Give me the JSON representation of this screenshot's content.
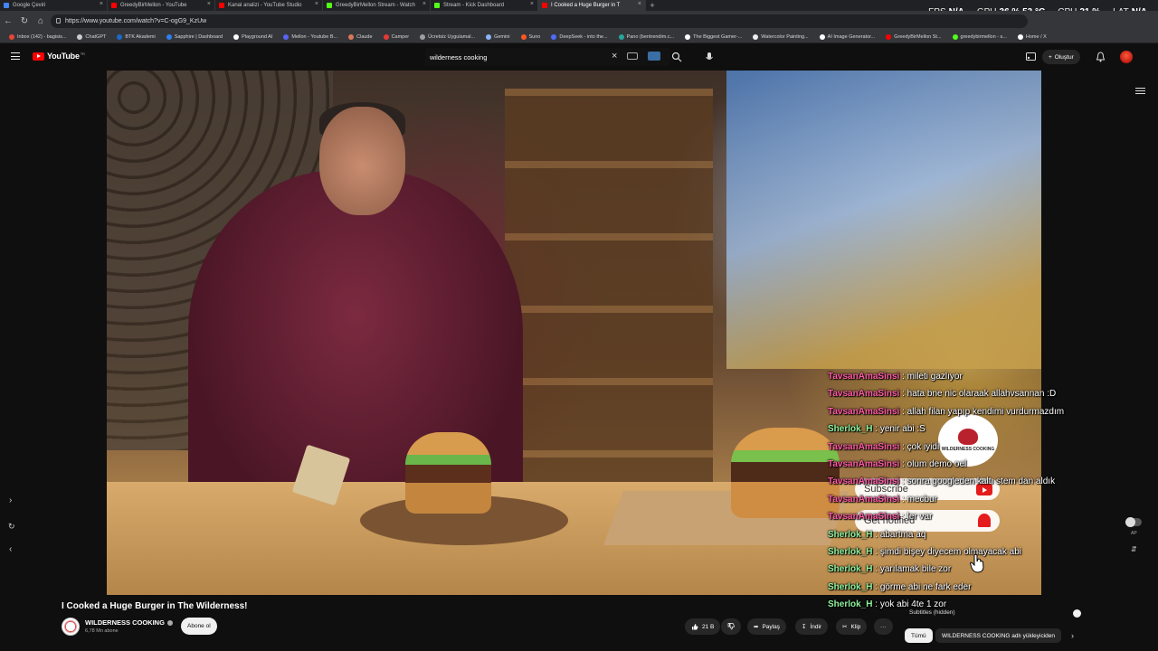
{
  "browser": {
    "tabs": [
      {
        "label": "Google Çeviri",
        "color": "#4285f4"
      },
      {
        "label": "GreedyBirMellon - YouTube",
        "color": "#ff0000"
      },
      {
        "label": "Kanal analizi - YouTube Studio",
        "color": "#ff0000"
      },
      {
        "label": "GreedyBirMellon Stream - Watch",
        "color": "#53fc18"
      },
      {
        "label": "Stream - Kick Dashboard",
        "color": "#53fc18"
      },
      {
        "label": "I Cooked a Huge Burger in T",
        "color": "#ff0000",
        "active": true
      }
    ],
    "new_tab": "+",
    "url": "https://www.youtube.com/watch?v=C-ogG9_KzUw",
    "bookmarks": [
      {
        "label": "Inbox (142) - bagisis...",
        "color": "#ea4335"
      },
      {
        "label": "ChatGPT",
        "color": "#cccccc"
      },
      {
        "label": "BTK Akademi",
        "color": "#1b6ac9"
      },
      {
        "label": "Sapphire | Dashboard",
        "color": "#2f80ed"
      },
      {
        "label": "Playground AI",
        "color": "#ffffff"
      },
      {
        "label": "Mellon - Youtube B...",
        "color": "#5865f2"
      },
      {
        "label": "Claude",
        "color": "#d97757"
      },
      {
        "label": "Camper",
        "color": "#e53935"
      },
      {
        "label": "Ücretsiz Uygulamal...",
        "color": "#9e9e9e"
      },
      {
        "label": "Gemini",
        "color": "#8ab4f8"
      },
      {
        "label": "Suno",
        "color": "#ff5722"
      },
      {
        "label": "DeepSeek - into the...",
        "color": "#4d6bfe"
      },
      {
        "label": "Pano (bentrendim.c...",
        "color": "#26a69a"
      },
      {
        "label": "The Biggest Gamer-...",
        "color": "#ffffff"
      },
      {
        "label": "Watercolor Painting...",
        "color": "#eeeeee"
      },
      {
        "label": "AI Image Generator...",
        "color": "#ffffff"
      },
      {
        "label": "GreedyBirMellon St...",
        "color": "#ff0000"
      },
      {
        "label": "greedybirmellon - s...",
        "color": "#53fc18"
      },
      {
        "label": "Home / X",
        "color": "#ffffff"
      }
    ]
  },
  "stats_overlay": {
    "fps_label": "FPS",
    "fps_value": "N/A",
    "gpu_label": "GPU",
    "gpu_value": "36 % 53 °C",
    "cpu_label": "CPU",
    "cpu_value": "21 %",
    "lat_label": "LAT",
    "lat_value": "N/A"
  },
  "youtube": {
    "logo_text": "YouTube",
    "region": "TR",
    "search_value": "wilderness cooking",
    "create_label": "Oluştur",
    "video_title": "I Cooked a Huge Burger in The Wilderness!",
    "channel_name": "WILDERNESS COOKING",
    "subscriber_count": "6,78 Mn abone",
    "subscribe_label": "Abone ol",
    "likes": "21 B",
    "share_label": "Paylaş",
    "download_label": "İndir",
    "clip_label": "Klip",
    "more_label": "···",
    "subtitles_hidden": "Subtitles (hidden)",
    "chips": [
      "Tümü",
      "WILDERNESS COOKING adlı yükleyiciden"
    ],
    "autoplay_label": "AP"
  },
  "chat": [
    {
      "user": "TavsanAmaSinsi",
      "color": "#ff5aa5",
      "message": "mileti gazlıyor"
    },
    {
      "user": "TavsanAmaSinsi",
      "color": "#ff5aa5",
      "message": "hata bne nic olaraak allahvsannan :D"
    },
    {
      "user": "TavsanAmaSinsi",
      "color": "#ff5aa5",
      "message": "allah filan yapıp kendimi vurdurmazdım"
    },
    {
      "user": "Sherlok_H",
      "color": "#8ef29c",
      "message": "yenir abi :S"
    },
    {
      "user": "TavsanAmaSinsi",
      "color": "#ff5aa5",
      "message": "çok iyidi"
    },
    {
      "user": "TavsanAmaSinsi",
      "color": "#ff5aa5",
      "message": "olum demo oel"
    },
    {
      "user": "TavsanAmaSinsi",
      "color": "#ff5aa5",
      "message": "sonra googleden kaltı stem dan aldık"
    },
    {
      "user": "TavsanAmaSinsi",
      "color": "#ff5aa5",
      "message": "mecbur"
    },
    {
      "user": "TavsanAmaSinsi",
      "color": "#ff5aa5",
      "message": "ler var"
    },
    {
      "user": "Sherlok_H",
      "color": "#8ef29c",
      "message": "abartma aq"
    },
    {
      "user": "Sherlok_H",
      "color": "#8ef29c",
      "message": "şimdi bişey diyecem olmayacak abi"
    },
    {
      "user": "Sherlok_H",
      "color": "#8ef29c",
      "message": "yarılamak bile zor"
    },
    {
      "user": "Sherlok_H",
      "color": "#8ef29c",
      "message": "görme abi ne fark eder"
    },
    {
      "user": "Sherlok_H",
      "color": "#8ef29c",
      "message": "yok abi 4te 1 zor"
    }
  ],
  "sub_widget": {
    "logo_text": "WILDERNESS COOKING",
    "subscribe_text": "Subscribe",
    "notify_text": "Get notified"
  }
}
